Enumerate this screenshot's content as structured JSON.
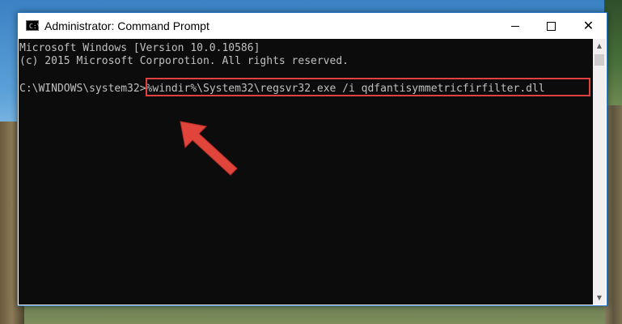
{
  "window": {
    "title": "Administrator: Command Prompt"
  },
  "console": {
    "lines": [
      "Microsoft Windows [Version 10.0.10586]",
      "(c) 2015 Microsoft Corporotion. All rights reserved."
    ],
    "prompt": "C:\\WINDOWS\\system32>",
    "command": "%windir%\\System32\\regsvr32.exe /i qdfantisymmetricfirfilter.dll"
  },
  "icons": {
    "app": "cmd-icon",
    "minimize": "minimize-icon",
    "maximize": "maximize-icon",
    "close": "close-icon",
    "annotation": "red-arrow-icon"
  },
  "colors": {
    "highlight_border": "#e04040",
    "arrow": "#e0443a",
    "console_bg": "#0c0c0c",
    "console_text": "#c0c0c0"
  }
}
